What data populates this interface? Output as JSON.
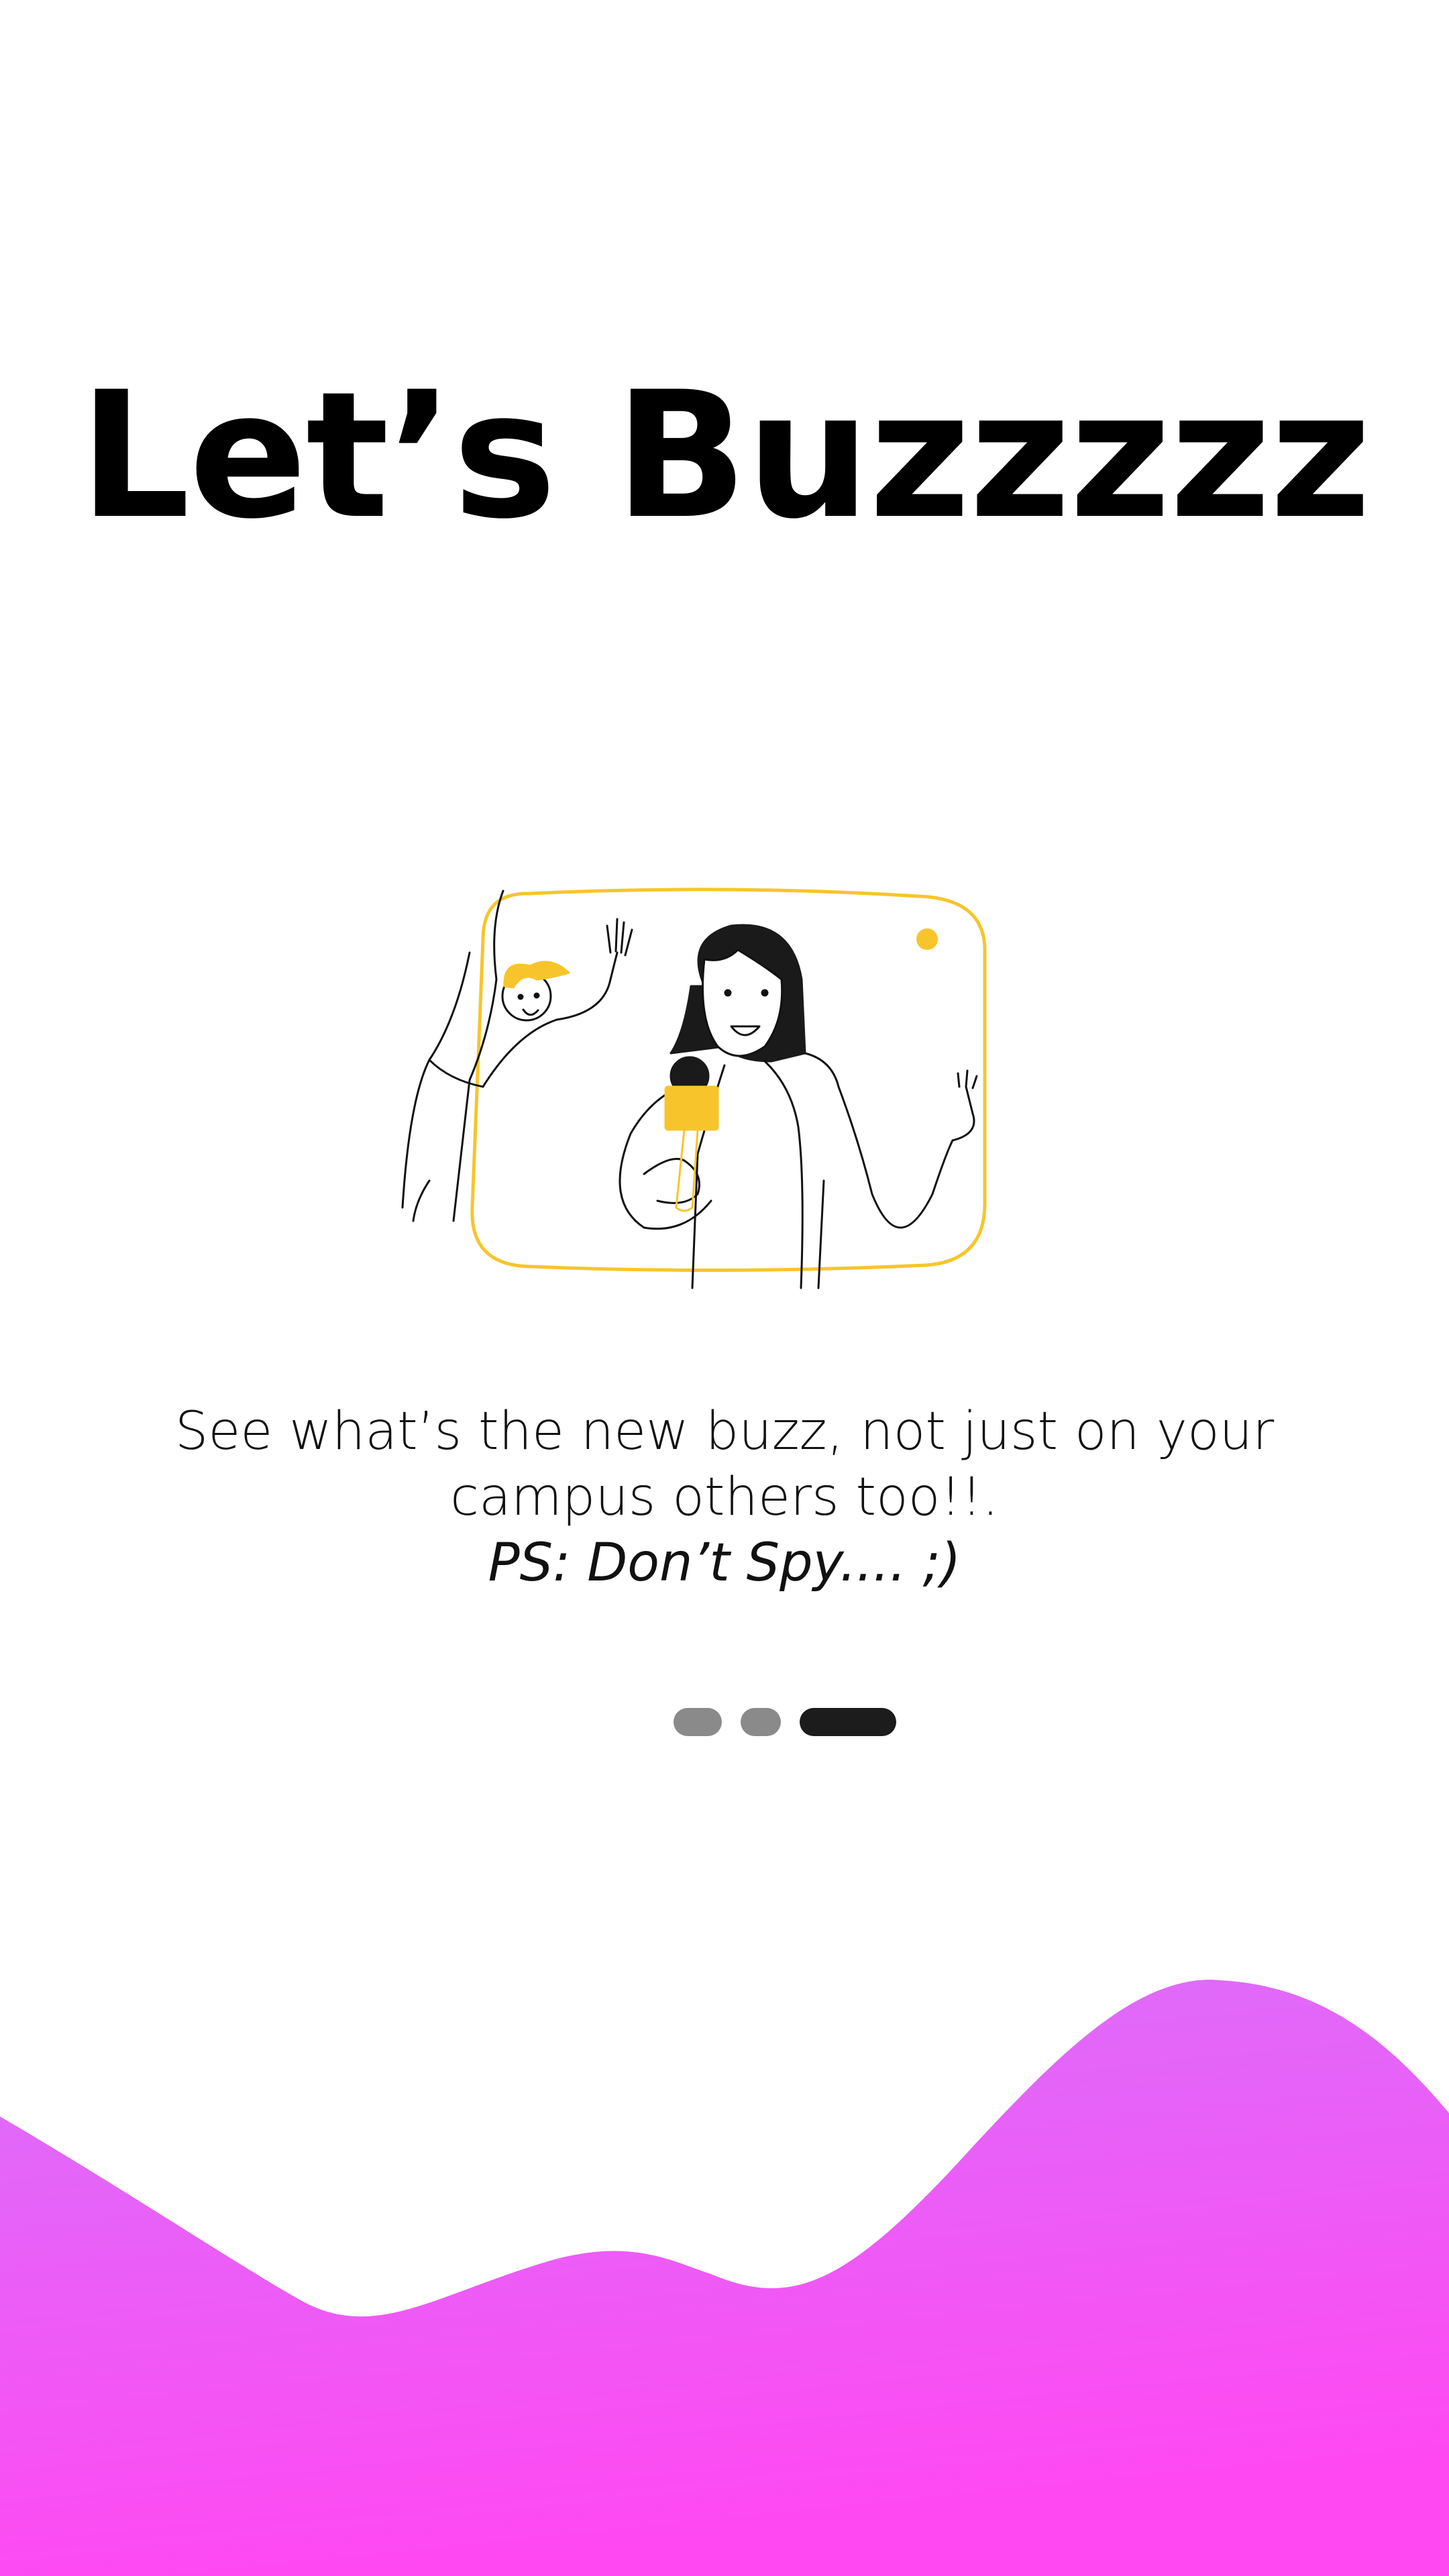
{
  "onboarding": {
    "title": "Let’s Buzzzzz",
    "description_line1": "See what’s the new buzz, not just on your",
    "description_line2": "campus others too!!.",
    "description_ps": "PS: Don’t Spy.... ;)",
    "pager": {
      "total": 3,
      "current": 3
    }
  },
  "colors": {
    "background": "#ffffff",
    "accent_yellow": "#F7C52B",
    "wave_top": "#D872FB",
    "wave_bottom": "#FF48F2",
    "dot_inactive": "#8a8a8a",
    "dot_active": "#1c1c1c"
  },
  "icons": {
    "illustration": "reporter-with-microphone-illustration"
  }
}
